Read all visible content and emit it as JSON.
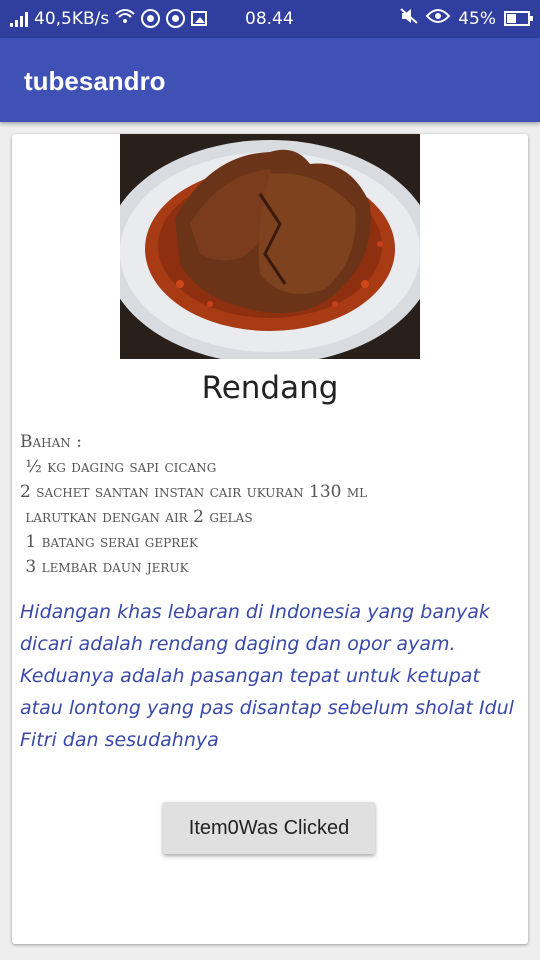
{
  "status_bar": {
    "net_speed": "40,5KB/s",
    "time": "08.44",
    "battery": "45%"
  },
  "app": {
    "title": "tubesandro"
  },
  "recipe": {
    "image_alt": "Rendang dish on a white plate",
    "title": "Rendang",
    "ingredients": [
      "Bahan :",
      " ½ kg daging sapi cicang",
      "2 sachet santan instan cair ukuran 130 ml",
      " larutkan dengan air 2 gelas",
      " 1 batang serai geprek",
      " 3 lembar daun jeruk"
    ],
    "description": "Hidangan khas lebaran di Indonesia yang banyak dicari adalah rendang daging dan opor ayam. Keduanya adalah pasangan tepat untuk ketupat atau lontong yang pas disantap sebelum sholat Idul Fitri dan sesudahnya",
    "button_label": "Item0Was Clicked"
  }
}
